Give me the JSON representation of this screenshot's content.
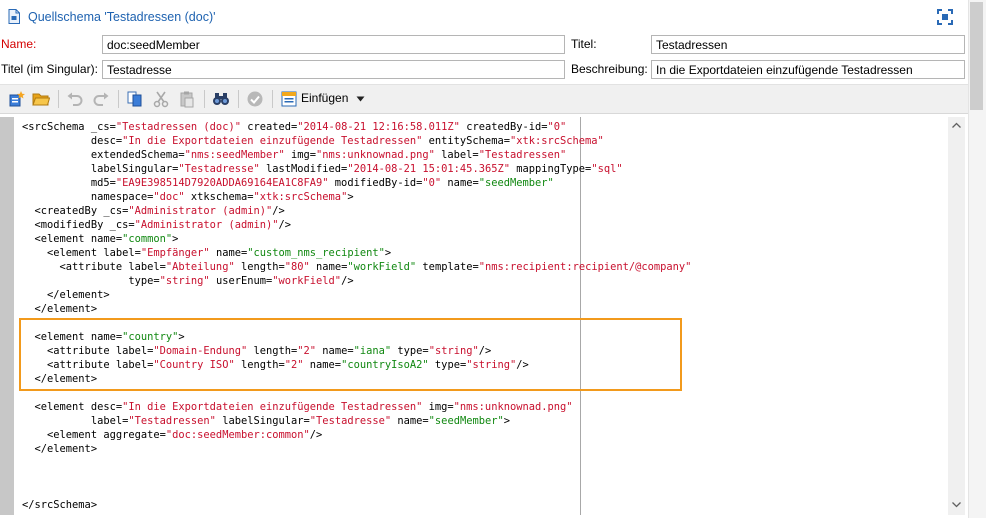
{
  "window": {
    "title": "Quellschema 'Testadressen (doc)'"
  },
  "form": {
    "name_label": "Name:",
    "name_value": "doc:seedMember",
    "titel_label": "Titel:",
    "titel_value": "Testadressen",
    "singular_label": "Titel (im Singular):",
    "singular_value": "Testadresse",
    "beschreibung_label": "Beschreibung:",
    "beschreibung_value": "In die Exportdateien einzufügende Testadressen"
  },
  "toolbar": {
    "icons": [
      "new-schema-icon",
      "open-folder-icon",
      "undo-icon",
      "redo-icon",
      "copy-icon",
      "cut-icon",
      "paste-icon",
      "find-icon",
      "check-icon",
      "insert-icon"
    ],
    "einfuegen_label": "Einfügen"
  },
  "colors": {
    "title": "#1e62b0",
    "required_label": "#d40000",
    "string_value": "#c8102e",
    "name_value": "#118811",
    "highlight_border": "#f29a1c"
  },
  "code": {
    "lines": [
      [
        [
          "at",
          "<srcSchema _cs="
        ],
        [
          "st",
          "\"Testadressen (doc)\""
        ],
        [
          "at",
          " created="
        ],
        [
          "st",
          "\"2014-08-21 12:16:58.011Z\""
        ],
        [
          "at",
          " createdBy-id="
        ],
        [
          "st",
          "\"0\""
        ]
      ],
      [
        [
          "at",
          "           desc="
        ],
        [
          "st",
          "\"In die Exportdateien einzufügende Testadressen\""
        ],
        [
          "at",
          " entitySchema="
        ],
        [
          "st",
          "\"xtk:srcSchema\""
        ]
      ],
      [
        [
          "at",
          "           extendedSchema="
        ],
        [
          "st",
          "\"nms:seedMember\""
        ],
        [
          "at",
          " img="
        ],
        [
          "st",
          "\"nms:unknownad.png\""
        ],
        [
          "at",
          " label="
        ],
        [
          "st",
          "\"Testadressen\""
        ]
      ],
      [
        [
          "at",
          "           labelSingular="
        ],
        [
          "st",
          "\"Testadresse\""
        ],
        [
          "at",
          " lastModified="
        ],
        [
          "st",
          "\"2014-08-21 15:01:45.365Z\""
        ],
        [
          "at",
          " mappingType="
        ],
        [
          "st",
          "\"sql\""
        ]
      ],
      [
        [
          "at",
          "           md5="
        ],
        [
          "st",
          "\"EA9E398514D7920ADDA69164EA1C8FA9\""
        ],
        [
          "at",
          " modifiedBy-id="
        ],
        [
          "st",
          "\"0\""
        ],
        [
          "at",
          " name="
        ],
        [
          "gn",
          "\"seedMember\""
        ]
      ],
      [
        [
          "at",
          "           namespace="
        ],
        [
          "st",
          "\"doc\""
        ],
        [
          "at",
          " xtkschema="
        ],
        [
          "st",
          "\"xtk:srcSchema\""
        ],
        [
          "at",
          ">"
        ]
      ],
      [
        [
          "at",
          "  <createdBy _cs="
        ],
        [
          "st",
          "\"Administrator (admin)\""
        ],
        [
          "at",
          "/>"
        ]
      ],
      [
        [
          "at",
          "  <modifiedBy _cs="
        ],
        [
          "st",
          "\"Administrator (admin)\""
        ],
        [
          "at",
          "/>"
        ]
      ],
      [
        [
          "at",
          "  <element name="
        ],
        [
          "gn",
          "\"common\""
        ],
        [
          "at",
          ">"
        ]
      ],
      [
        [
          "at",
          "    <element label="
        ],
        [
          "st",
          "\"Empfänger\""
        ],
        [
          "at",
          " name="
        ],
        [
          "gn",
          "\"custom_nms_recipient\""
        ],
        [
          "at",
          ">"
        ]
      ],
      [
        [
          "at",
          "      <attribute label="
        ],
        [
          "st",
          "\"Abteilung\""
        ],
        [
          "at",
          " length="
        ],
        [
          "st",
          "\"80\""
        ],
        [
          "at",
          " name="
        ],
        [
          "gn",
          "\"workField\""
        ],
        [
          "at",
          " template="
        ],
        [
          "st",
          "\"nms:recipient:recipient/@company\""
        ]
      ],
      [
        [
          "at",
          "                 type="
        ],
        [
          "st",
          "\"string\""
        ],
        [
          "at",
          " userEnum="
        ],
        [
          "st",
          "\"workField\""
        ],
        [
          "at",
          "/>"
        ]
      ],
      [
        [
          "at",
          "    </element>"
        ]
      ],
      [
        [
          "at",
          "  </element>"
        ]
      ],
      [
        [
          "at",
          ""
        ]
      ],
      [
        [
          "at",
          "  <element name="
        ],
        [
          "gn",
          "\"country\""
        ],
        [
          "at",
          ">"
        ]
      ],
      [
        [
          "at",
          "    <attribute label="
        ],
        [
          "st",
          "\"Domain-Endung\""
        ],
        [
          "at",
          " length="
        ],
        [
          "st",
          "\"2\""
        ],
        [
          "at",
          " name="
        ],
        [
          "gn",
          "\"iana\""
        ],
        [
          "at",
          " type="
        ],
        [
          "st",
          "\"string\""
        ],
        [
          "at",
          "/>"
        ]
      ],
      [
        [
          "at",
          "    <attribute label="
        ],
        [
          "st",
          "\"Country ISO\""
        ],
        [
          "at",
          " length="
        ],
        [
          "st",
          "\"2\""
        ],
        [
          "at",
          " name="
        ],
        [
          "gn",
          "\"countryIsoA2\""
        ],
        [
          "at",
          " type="
        ],
        [
          "st",
          "\"string\""
        ],
        [
          "at",
          "/>"
        ]
      ],
      [
        [
          "at",
          "  </element>"
        ]
      ],
      [
        [
          "at",
          ""
        ]
      ],
      [
        [
          "at",
          "  <element desc="
        ],
        [
          "st",
          "\"In die Exportdateien einzufügende Testadressen\""
        ],
        [
          "at",
          " img="
        ],
        [
          "st",
          "\"nms:unknownad.png\""
        ]
      ],
      [
        [
          "at",
          "           label="
        ],
        [
          "st",
          "\"Testadressen\""
        ],
        [
          "at",
          " labelSingular="
        ],
        [
          "st",
          "\"Testadresse\""
        ],
        [
          "at",
          " name="
        ],
        [
          "gn",
          "\"seedMember\""
        ],
        [
          "at",
          ">"
        ]
      ],
      [
        [
          "at",
          "    <element aggregate="
        ],
        [
          "st",
          "\"doc:seedMember:common\""
        ],
        [
          "at",
          "/>"
        ]
      ],
      [
        [
          "at",
          "  </element>"
        ]
      ],
      [
        [
          "at",
          ""
        ]
      ],
      [
        [
          "at",
          ""
        ]
      ],
      [
        [
          "at",
          ""
        ]
      ],
      [
        [
          "at",
          "</srcSchema>"
        ]
      ]
    ]
  }
}
